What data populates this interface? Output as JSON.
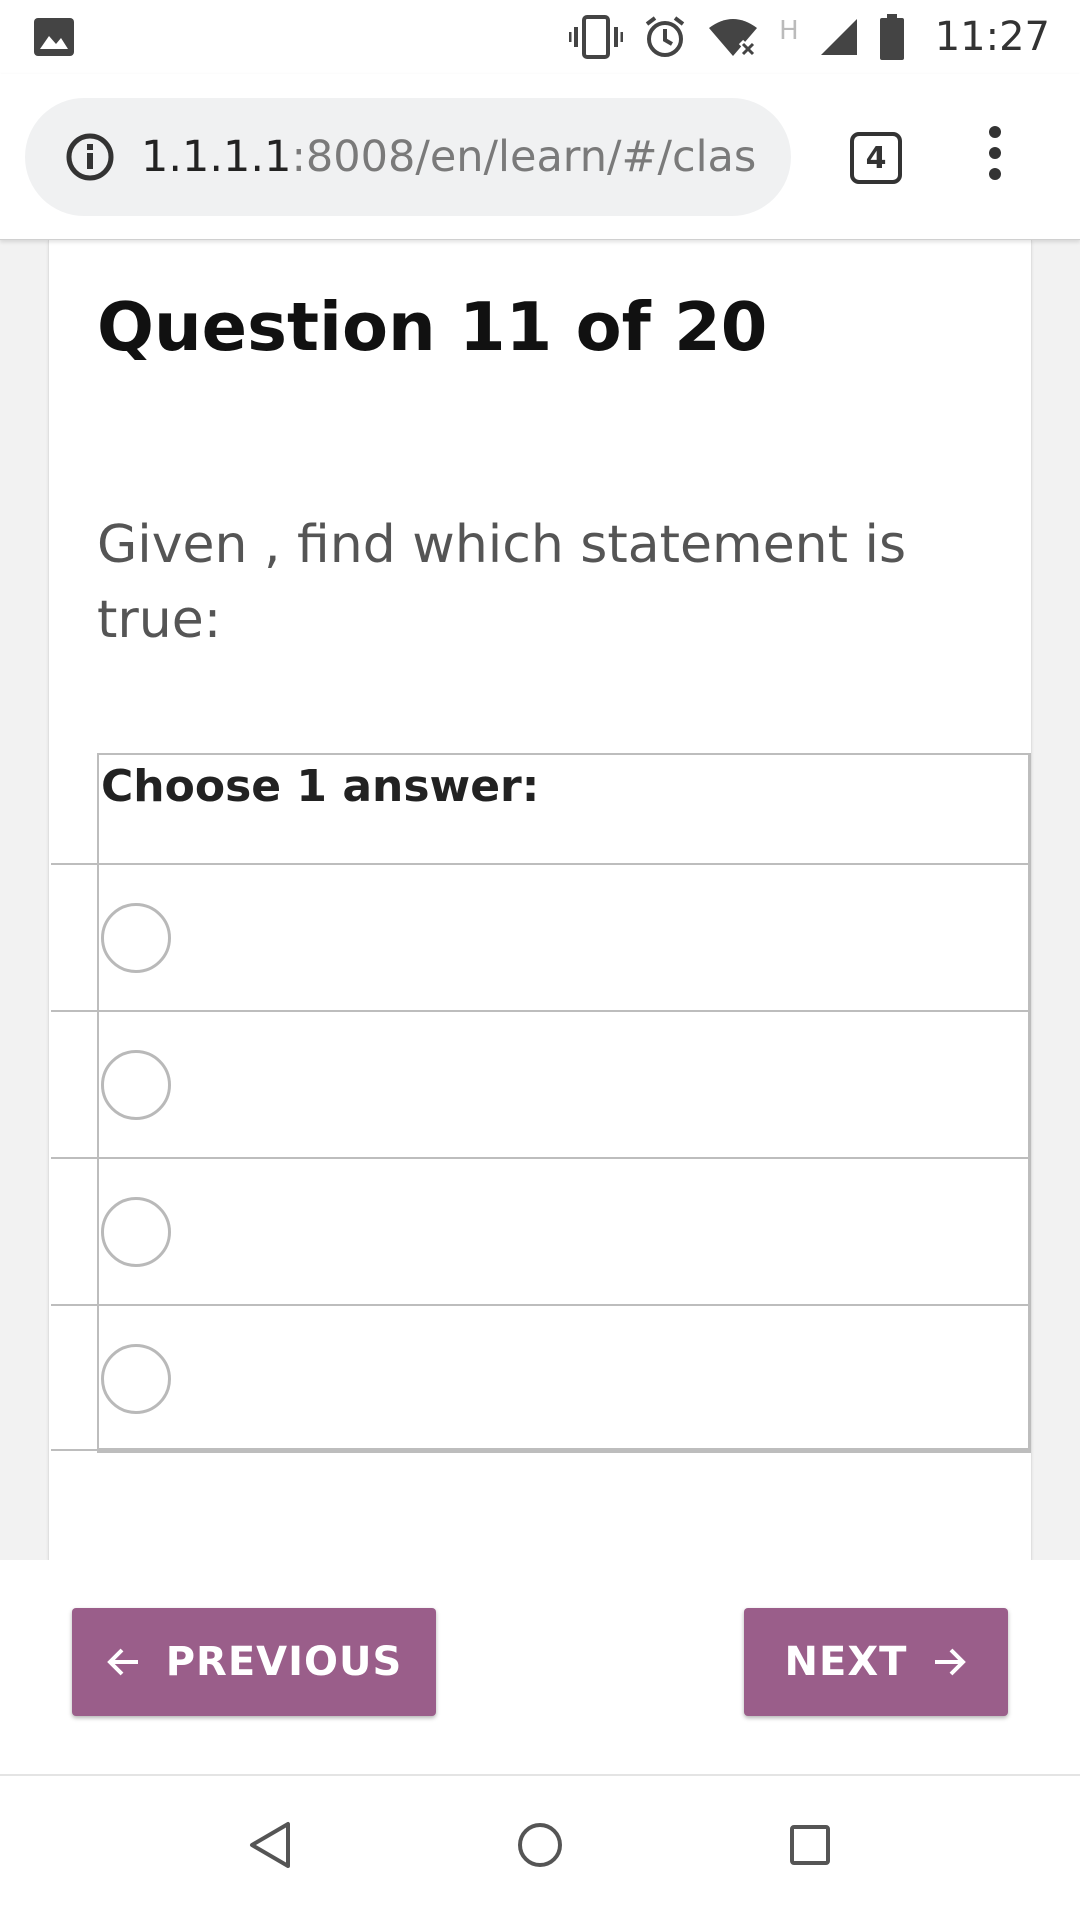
{
  "status_bar": {
    "time": "11:27",
    "network_label": "H",
    "icons": [
      "gallery-icon",
      "vibrate-icon",
      "alarm-icon",
      "wifi-off-icon",
      "signal-icon",
      "battery-icon"
    ]
  },
  "browser": {
    "url_host": "1.1.1.1",
    "url_rest": ":8008/en/learn/#/clas",
    "tab_count": "4"
  },
  "question": {
    "title": "Question 11 of 20",
    "text": "Given , find which statement is true:",
    "choose_label": "Choose 1 answer:",
    "options": [
      "",
      "",
      "",
      ""
    ]
  },
  "actions": {
    "previous_label": "PREVIOUS",
    "next_label": "NEXT"
  },
  "theme": {
    "accent": "#9a5e8a"
  }
}
